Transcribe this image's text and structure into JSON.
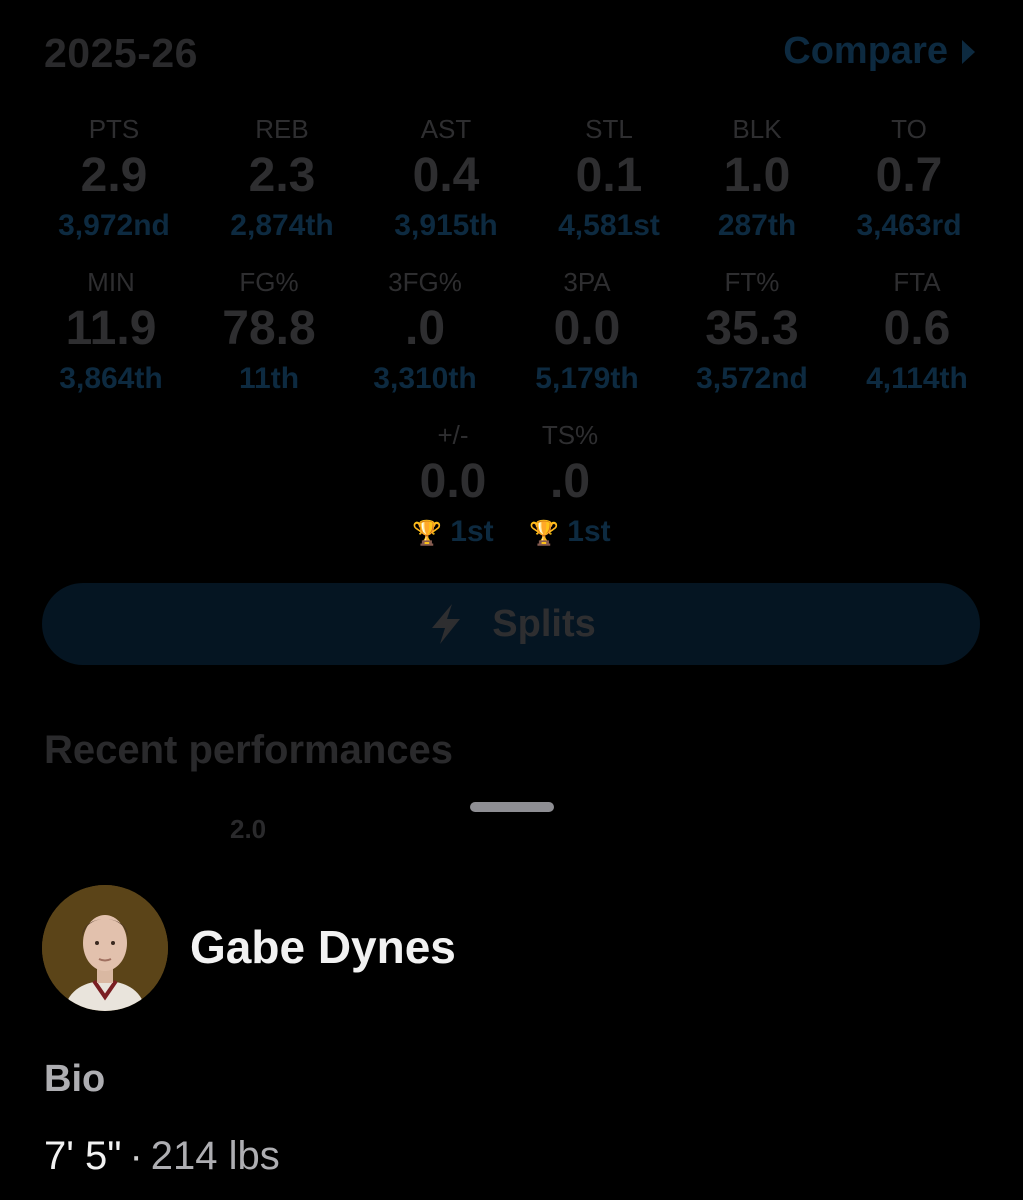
{
  "header": {
    "season": "2025-26",
    "compare_label": "Compare"
  },
  "stat_rows": [
    [
      {
        "label": "PTS",
        "value": "2.9",
        "rank": "3,972nd"
      },
      {
        "label": "REB",
        "value": "2.3",
        "rank": "2,874th"
      },
      {
        "label": "AST",
        "value": "0.4",
        "rank": "3,915th"
      },
      {
        "label": "STL",
        "value": "0.1",
        "rank": "4,581st"
      },
      {
        "label": "BLK",
        "value": "1.0",
        "rank": "287th"
      },
      {
        "label": "TO",
        "value": "0.7",
        "rank": "3,463rd"
      }
    ],
    [
      {
        "label": "MIN",
        "value": "11.9",
        "rank": "3,864th"
      },
      {
        "label": "FG%",
        "value": "78.8",
        "rank": "11th"
      },
      {
        "label": "3FG%",
        "value": ".0",
        "rank": "3,310th"
      },
      {
        "label": "3PA",
        "value": "0.0",
        "rank": "5,179th"
      },
      {
        "label": "FT%",
        "value": "35.3",
        "rank": "3,572nd"
      },
      {
        "label": "FTA",
        "value": "0.6",
        "rank": "4,114th"
      }
    ],
    [
      {
        "label": "+/-",
        "value": "0.0",
        "rank": "1st",
        "trophy": true
      },
      {
        "label": "TS%",
        "value": ".0",
        "rank": "1st",
        "trophy": true
      }
    ]
  ],
  "splits": {
    "label": "Splits",
    "icon": "lightning-bolt-icon"
  },
  "recent": {
    "title": "Recent performances",
    "value": "2.0"
  },
  "player": {
    "name": "Gabe Dynes"
  },
  "bio": {
    "label": "Bio",
    "height": "7' 5\"",
    "separator": "·",
    "weight": "214 lbs"
  },
  "colors": {
    "background": "#000000",
    "accent": "#0d2a40",
    "muted_text": "#2e2e30",
    "avatar_bg": "#5b4418"
  }
}
